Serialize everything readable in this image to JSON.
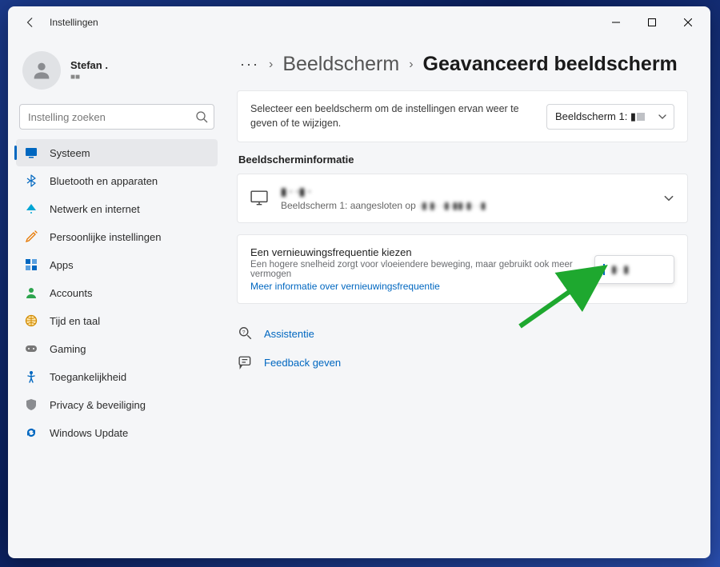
{
  "titlebar": {
    "title": "Instellingen"
  },
  "profile": {
    "name": "Stefan .",
    "sub": "■■"
  },
  "search": {
    "placeholder": "Instelling zoeken"
  },
  "nav": {
    "system": "Systeem",
    "bluetooth": "Bluetooth en apparaten",
    "network": "Netwerk en internet",
    "personalization": "Persoonlijke instellingen",
    "apps": "Apps",
    "accounts": "Accounts",
    "time": "Tijd en taal",
    "gaming": "Gaming",
    "accessibility": "Toegankelijkheid",
    "privacy": "Privacy & beveiliging",
    "update": "Windows Update"
  },
  "breadcrumb": {
    "dots": "···",
    "parent": "Beeldscherm",
    "current": "Geavanceerd beeldscherm"
  },
  "select_display": {
    "desc": "Selecteer een beeldscherm om de instellingen ervan weer te geven of te wijzigen.",
    "value": "Beeldscherm 1: ▮"
  },
  "info_section": {
    "label": "Beeldscherminformatie"
  },
  "display_info": {
    "title": "▮ · ·▮ ·",
    "sub_prefix": "Beeldscherm 1: aangesloten op",
    "sub_blur": "·▮ ▮· ·▮·▮▮·▮· ·▮"
  },
  "refresh": {
    "title": "Een vernieuwingsfrequentie kiezen",
    "sub": "Een hogere snelheid zorgt voor vloeiendere beweging, maar gebruikt ook meer vermogen",
    "link": "Meer informatie over vernieuwingsfrequentie",
    "value": "▮· ▮"
  },
  "actions": {
    "assist": "Assistentie",
    "feedback": "Feedback geven"
  }
}
